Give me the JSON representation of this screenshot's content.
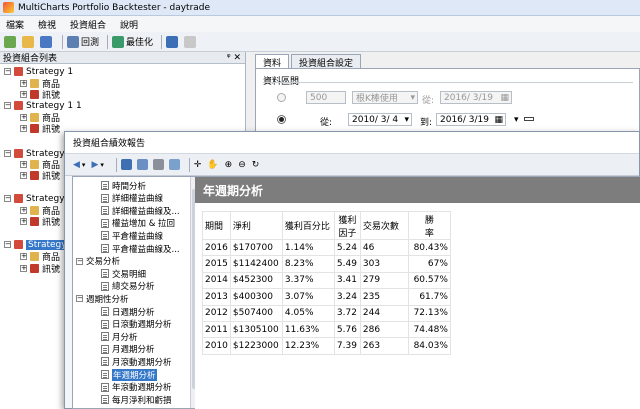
{
  "window": {
    "title": "MultiCharts Portfolio Backtester - daytrade"
  },
  "menu": [
    "檔案",
    "檢視",
    "投資組合",
    "說明"
  ],
  "toolbar": {
    "backtest_label": "回測",
    "optimize_label": "最佳化"
  },
  "left_panel": {
    "title": "投資組合列表",
    "pin": "ᵠ ✕",
    "tree": [
      {
        "label": "Strategy 1",
        "depth": 0
      },
      {
        "label": "商品",
        "depth": 1
      },
      {
        "label": "訊號",
        "depth": 1
      },
      {
        "label": "Strategy 1 1",
        "depth": 0
      },
      {
        "label": "商品",
        "depth": 1
      },
      {
        "label": "訊號",
        "depth": 1
      },
      {
        "label": "Strategy",
        "depth": 0
      },
      {
        "label": "商品",
        "depth": 1
      },
      {
        "label": "訊號",
        "depth": 1
      },
      {
        "label": "Strategy",
        "depth": 0
      },
      {
        "label": "商品",
        "depth": 1
      },
      {
        "label": "訊號",
        "depth": 1
      },
      {
        "label": "Strategy",
        "depth": 0,
        "selected": true
      },
      {
        "label": "商品",
        "depth": 1
      },
      {
        "label": "訊號",
        "depth": 1
      }
    ]
  },
  "right_panel": {
    "tabs": [
      "資料",
      "投資組合設定"
    ],
    "section": "資料區間",
    "bars_value": "500",
    "bars_unit": "根K棒使用",
    "from_label": "從:",
    "to_label": "到:",
    "date_disabled": "2016/ 3/19",
    "date_from": "2010/ 3/ 4",
    "date_to": "2016/ 3/19"
  },
  "dialog": {
    "title": "投資組合績效報告",
    "nav": [
      {
        "label": "時間分析",
        "depth": 2
      },
      {
        "label": "詳細權益曲線",
        "depth": 2
      },
      {
        "label": "詳細權益曲線及...",
        "depth": 2
      },
      {
        "label": "權益增加 & 拉回",
        "depth": 2
      },
      {
        "label": "平倉權益曲線",
        "depth": 2
      },
      {
        "label": "平倉權益曲線及...",
        "depth": 2
      },
      {
        "label": "交易分析",
        "depth": 0,
        "expander": true
      },
      {
        "label": "交易明細",
        "depth": 2
      },
      {
        "label": "總交易分析",
        "depth": 2
      },
      {
        "label": "週期性分析",
        "depth": 0,
        "expander": true
      },
      {
        "label": "日週期分析",
        "depth": 2
      },
      {
        "label": "日滾動週期分析",
        "depth": 2
      },
      {
        "label": "月分析",
        "depth": 2
      },
      {
        "label": "月週期分析",
        "depth": 2
      },
      {
        "label": "月滾動週期分析",
        "depth": 2
      },
      {
        "label": "年週期分析",
        "depth": 2,
        "selected": true
      },
      {
        "label": "年滾動週期分析",
        "depth": 2
      },
      {
        "label": "每月淨利和虧損",
        "depth": 2
      }
    ],
    "report": {
      "title": "年週期分析",
      "headers": [
        "期間",
        "淨利",
        "獲利百分比",
        "獲利\n因子",
        "交易次數",
        "勝\n率"
      ],
      "rows": [
        [
          "2016",
          "$170700",
          "1.14%",
          "5.24",
          "46",
          "80.43%"
        ],
        [
          "2015",
          "$1142400",
          "8.23%",
          "5.49",
          "303",
          "67%"
        ],
        [
          "2014",
          "$452300",
          "3.37%",
          "3.41",
          "279",
          "60.57%"
        ],
        [
          "2013",
          "$400300",
          "3.07%",
          "3.24",
          "235",
          "61.7%"
        ],
        [
          "2012",
          "$507400",
          "4.05%",
          "3.72",
          "244",
          "72.13%"
        ],
        [
          "2011",
          "$1305100",
          "11.63%",
          "5.76",
          "286",
          "74.48%"
        ],
        [
          "2010",
          "$1223000",
          "12.23%",
          "7.39",
          "263",
          "84.03%"
        ]
      ]
    }
  }
}
